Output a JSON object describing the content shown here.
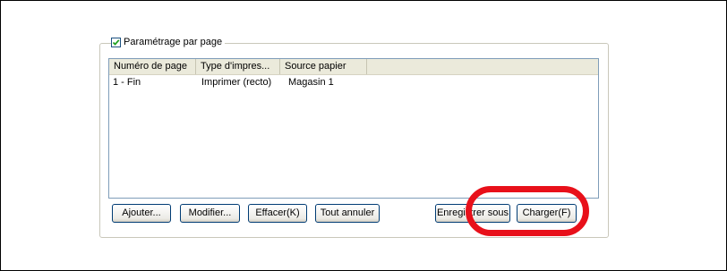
{
  "group": {
    "checkbox_label": "Paramétrage par page",
    "checked": true
  },
  "list": {
    "columns": [
      "Numéro de page",
      "Type d'impres...",
      "Source papier"
    ],
    "rows": [
      [
        "1 - Fin",
        "Imprimer (recto)",
        "Magasin 1"
      ]
    ]
  },
  "buttons": {
    "add": "Ajouter...",
    "modify": "Modifier...",
    "delete": "Effacer(K)",
    "cancel_all": "Tout annuler",
    "save_as": "Enregistrer sous",
    "load": "Charger(F)"
  },
  "colors": {
    "highlight": "#e8101a",
    "button_border": "#003c74",
    "list_border": "#7f9db9"
  }
}
